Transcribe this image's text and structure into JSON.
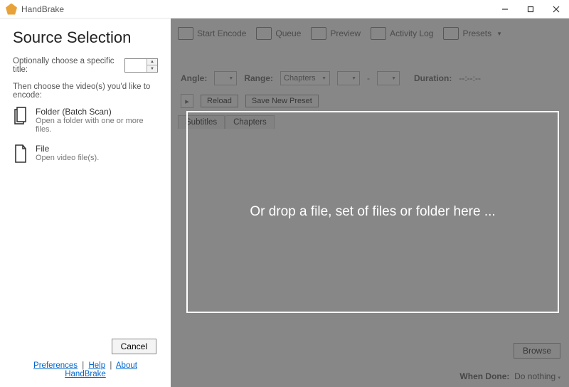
{
  "app": {
    "title": "HandBrake"
  },
  "window_controls": {
    "minimize": "minimize",
    "maximize": "maximize",
    "close": "close"
  },
  "source_panel": {
    "heading": "Source Selection",
    "optional_title_label": "Optionally choose a specific title:",
    "optional_title_value": "",
    "then_line": "Then choose the video(s) you'd like to encode:",
    "folder_option": {
      "label": "Folder (Batch Scan)",
      "desc": "Open a folder with one or more files."
    },
    "file_option": {
      "label": "File",
      "desc": "Open video file(s)."
    },
    "cancel": "Cancel"
  },
  "footer": {
    "preferences": "Preferences",
    "help": "Help",
    "about": "About HandBrake"
  },
  "toolbar": {
    "start_encode": "Start Encode",
    "queue": "Queue",
    "preview": "Preview",
    "activity_log": "Activity Log",
    "presets": "Presets"
  },
  "settings_row": {
    "angle_label": "Angle:",
    "range_label": "Range:",
    "range_value": "Chapters",
    "range_sep": "-",
    "duration_label": "Duration:",
    "duration_value": "--:--:--"
  },
  "preset_row": {
    "reload": "Reload",
    "save_new": "Save New Preset"
  },
  "tabs": {
    "subtitles": "Subtitles",
    "chapters": "Chapters"
  },
  "browse": "Browse",
  "when_done": {
    "label": "When Done:",
    "value": "Do nothing"
  },
  "dropzone": {
    "text": "Or drop a file, set of files or folder here ..."
  }
}
